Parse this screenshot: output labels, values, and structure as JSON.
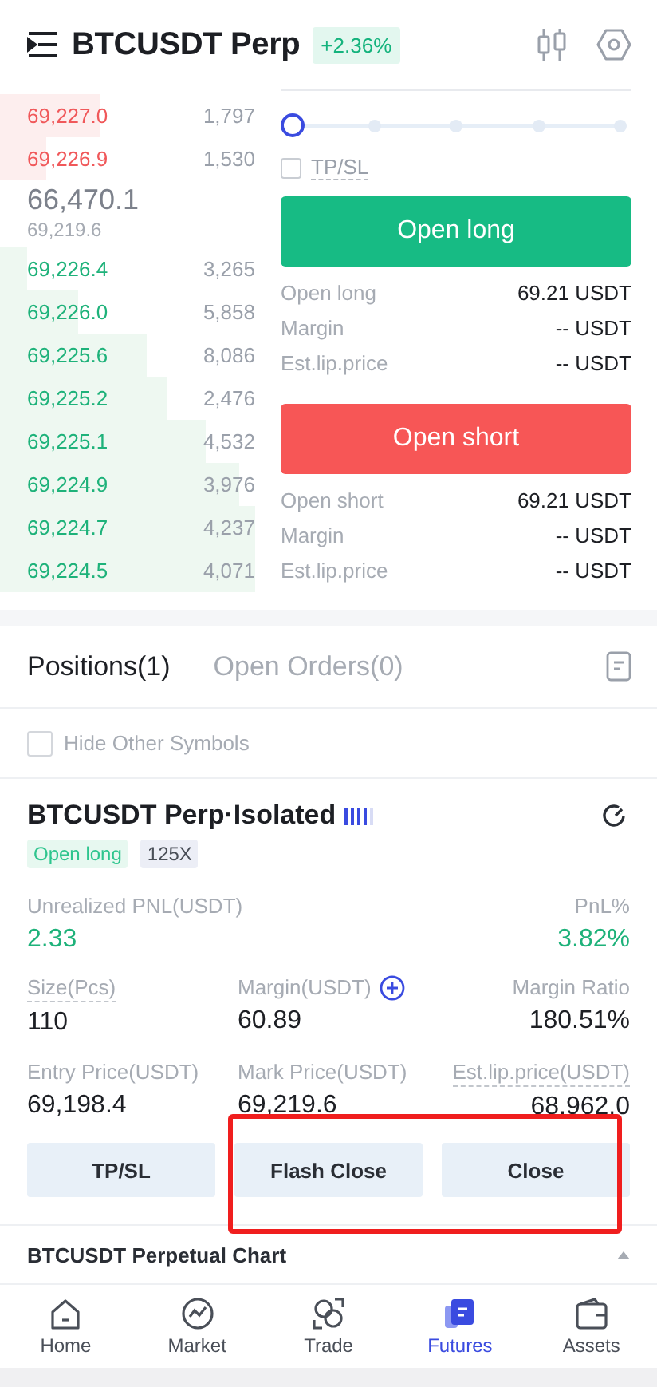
{
  "header": {
    "title": "BTCUSDT Perp",
    "change": "+2.36%"
  },
  "order_book": {
    "asks": [
      {
        "price": "69,227.0",
        "qty": "1,797"
      },
      {
        "price": "69,226.9",
        "qty": "1,530"
      }
    ],
    "last_price": "66,470.1",
    "mark_price": "69,219.6",
    "bids": [
      {
        "price": "69,226.4",
        "qty": "3,265"
      },
      {
        "price": "69,226.0",
        "qty": "5,858"
      },
      {
        "price": "69,225.6",
        "qty": "8,086"
      },
      {
        "price": "69,225.2",
        "qty": "2,476"
      },
      {
        "price": "69,225.1",
        "qty": "4,532"
      },
      {
        "price": "69,224.9",
        "qty": "3,976"
      },
      {
        "price": "69,224.7",
        "qty": "4,237"
      },
      {
        "price": "69,224.5",
        "qty": "4,071"
      }
    ]
  },
  "order_form": {
    "leverage_slider": {
      "level": 0
    },
    "tpsl": {
      "label": "TP/SL",
      "checked": false
    },
    "actions": [
      {
        "kind": "long",
        "label": "Open long",
        "details": [
          {
            "label": "Open long",
            "value": "69.21 USDT"
          },
          {
            "label": "Margin",
            "value": "-- USDT"
          },
          {
            "label": "Est.lip.price",
            "value": "-- USDT"
          }
        ]
      },
      {
        "kind": "short",
        "label": "Open short",
        "details": [
          {
            "label": "Open short",
            "value": "69.21 USDT"
          },
          {
            "label": "Margin",
            "value": "-- USDT"
          },
          {
            "label": "Est.lip.price",
            "value": "-- USDT"
          }
        ]
      }
    ]
  },
  "positions": {
    "tabs": [
      {
        "label": "Positions(1)",
        "selected": true
      },
      {
        "label": "Open Orders(0)",
        "selected": false
      }
    ],
    "hide_other": {
      "label": "Hide Other Symbols",
      "checked": false
    },
    "card": {
      "title": "BTCUSDT Perp·Isolated",
      "tags": [
        {
          "kind": "side",
          "text": "Open long"
        },
        {
          "kind": "leverage",
          "text": "125X"
        }
      ],
      "pnl": {
        "label": "Unrealized PNL(USDT)",
        "value": "2.33"
      },
      "pnl_pct": {
        "label": "PnL%",
        "value": "3.82%"
      },
      "stats": [
        {
          "kind": "hint",
          "label": "Size(Pcs)",
          "value": "110"
        },
        {
          "kind": "add",
          "label": "Margin(USDT)",
          "value": "60.89"
        },
        {
          "kind": "plain",
          "label": "Margin Ratio",
          "value": "180.51%"
        },
        {
          "kind": "plain",
          "label": "Entry Price(USDT)",
          "value": "69,198.4"
        },
        {
          "kind": "plain",
          "label": "Mark Price(USDT)",
          "value": "69,219.6"
        },
        {
          "kind": "hint",
          "label": "Est.lip.price(USDT)",
          "value": "68,962.0"
        }
      ],
      "buttons": [
        "TP/SL",
        "Flash Close",
        "Close"
      ]
    }
  },
  "chart_bar": {
    "title": "BTCUSDT Perpetual Chart"
  },
  "nav": [
    {
      "label": "Home",
      "selected": false
    },
    {
      "label": "Market",
      "selected": false
    },
    {
      "label": "Trade",
      "selected": false
    },
    {
      "label": "Futures",
      "selected": true
    },
    {
      "label": "Assets",
      "selected": false
    }
  ],
  "annotation": {
    "kind": "highlight-box"
  }
}
